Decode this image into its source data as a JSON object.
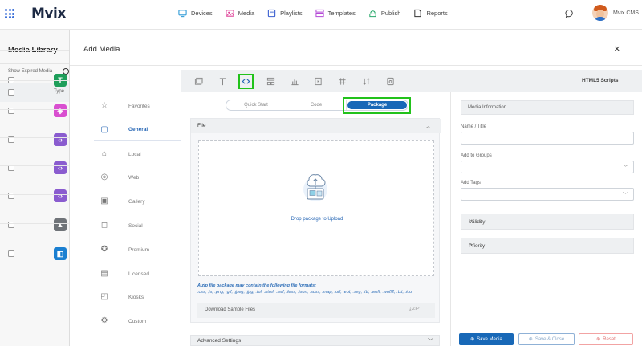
{
  "brand": {
    "name": "Mvix",
    "accent": "#1868b7",
    "highlight": "#22c21b"
  },
  "nav": [
    {
      "label": "Devices",
      "icon": "monitor-icon"
    },
    {
      "label": "Media",
      "icon": "media-icon"
    },
    {
      "label": "Playlists",
      "icon": "playlist-icon"
    },
    {
      "label": "Templates",
      "icon": "template-icon"
    },
    {
      "label": "Publish",
      "icon": "publish-icon"
    },
    {
      "label": "Reports",
      "icon": "reports-icon"
    }
  ],
  "user": {
    "name": "Mvix CMS"
  },
  "library": {
    "title": "Media Library",
    "show_expired": "Show Expired Media",
    "type_header": "Type",
    "rows": [
      {
        "glyph": "T",
        "color": "#1e9e5a"
      },
      {
        "glyph": "◈",
        "color": "#d94fd0"
      },
      {
        "glyph": "‹›",
        "color": "#8a5ccf"
      },
      {
        "glyph": "‹›",
        "color": "#8a5ccf"
      },
      {
        "glyph": "‹›",
        "color": "#8a5ccf"
      },
      {
        "glyph": "▲",
        "color": "#6f7378"
      },
      {
        "glyph": "◧",
        "color": "#1a7fd1"
      }
    ]
  },
  "modal": {
    "title": "Add Media",
    "close": "×",
    "categories": [
      {
        "label": "Favorites",
        "icon": "favorites-icon",
        "glyph": "☆"
      },
      {
        "label": "General",
        "icon": "general-icon",
        "glyph": "▢",
        "active": true
      },
      {
        "label": "Local",
        "icon": "local-icon",
        "glyph": "⌂"
      },
      {
        "label": "Web",
        "icon": "web-icon",
        "glyph": "◎"
      },
      {
        "label": "Gallery",
        "icon": "gallery-icon",
        "glyph": "▣"
      },
      {
        "label": "Social",
        "icon": "social-icon",
        "glyph": "◻"
      },
      {
        "label": "Premium",
        "icon": "premium-icon",
        "glyph": "✪"
      },
      {
        "label": "Licensed",
        "icon": "licensed-icon",
        "glyph": "▤"
      },
      {
        "label": "Kiosks",
        "icon": "kiosks-icon",
        "glyph": "◰"
      },
      {
        "label": "Custom",
        "icon": "custom-icon",
        "glyph": "⚙"
      }
    ],
    "toolbar_title": "HTML5 Scripts",
    "segments": [
      "Quick Start",
      "Code",
      "Package"
    ],
    "active_segment": "Package",
    "file_section": "File",
    "drop_text": "Drop package to Upload",
    "formats_title": "A zip file package may contain the following file formats:",
    "formats_list": ".css, .js, .png, .gif, .jpeg, .jpg, .tpl, .html, .swf, .less, .json, .scss, .map, .otf, .eot, .svg, .ttf, .woff, .woff2, .txt, .ico.",
    "sample_label": "Download Sample Files",
    "sample_zip": "ZIP",
    "advanced_label": "Advanced Settings",
    "info": {
      "header": "Media Information",
      "name_label": "Name / Title",
      "name_value": "",
      "groups_label": "Add to Groups",
      "tags_label": "Add Tags",
      "validity": "Validity",
      "priority": "Priority"
    },
    "buttons": {
      "save": "Save Media",
      "save_close": "Save & Close",
      "reset": "Reset"
    }
  }
}
